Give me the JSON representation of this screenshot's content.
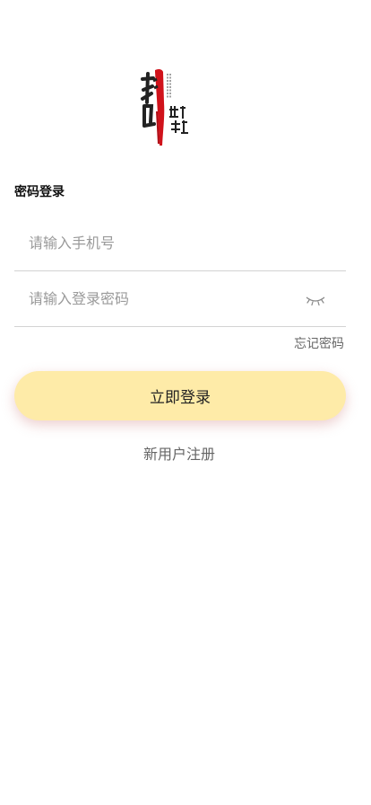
{
  "logo": {
    "name": "brand-logo",
    "colors": {
      "red": "#d0121b",
      "ink": "#222222"
    }
  },
  "page_title": "密码登录",
  "phone_field": {
    "placeholder": "请输入手机号",
    "value": ""
  },
  "password_field": {
    "placeholder": "请输入登录密码",
    "value": "",
    "visibility_icon": "eye-closed-icon"
  },
  "forgot_password_label": "忘记密码",
  "login_button": {
    "label": "立即登录",
    "background": "#feeba8"
  },
  "register_label": "新用户注册"
}
